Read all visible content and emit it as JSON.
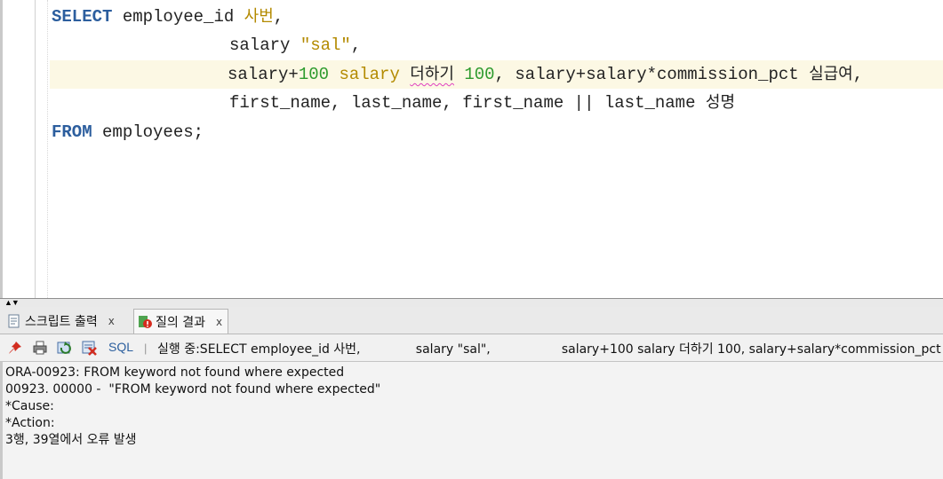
{
  "editor": {
    "line1": {
      "kw": "SELECT",
      "rest": " employee_id ",
      "alias": "사번",
      "tail": ","
    },
    "line2": {
      "col": "salary ",
      "str": "\"sal\"",
      "tail": ","
    },
    "line3": {
      "p1": "salary+",
      "n1": "100",
      "sp1": " ",
      "alias1": "salary",
      "sp2": " ",
      "ko1": "더하기",
      "sp3": " ",
      "n2": "100",
      "p2": ", salary+salary*commission_pct ",
      "ko2": "실급여",
      "tail": ","
    },
    "line4": {
      "text": "first_name, last_name, first_name || last_name ",
      "ko": "성명"
    },
    "line5": {
      "kw": "FROM",
      "rest": " employees;"
    }
  },
  "tabs": [
    {
      "label": "스크립트 출력",
      "close": "x",
      "icon": "script-output-icon"
    },
    {
      "label": "질의 결과",
      "close": "x",
      "icon": "query-result-icon"
    }
  ],
  "toolbar": {
    "sql_label": "SQL",
    "separator": "|",
    "status": "실행 중:SELECT employee_id 사번,              salary \"sal\",                  salary+100 salary 더하기 100, salary+salary*commission_pct 실급여,",
    "icons": [
      "pin-icon",
      "print-icon",
      "refresh-icon",
      "clear-icon"
    ]
  },
  "output": {
    "lines": [
      "ORA-00923: FROM keyword not found where expected",
      "00923. 00000 -  \"FROM keyword not found where expected\"",
      "*Cause:",
      "*Action:",
      "3행, 39열에서 오류 발생"
    ]
  },
  "colors": {
    "keyword": "#2c5e9e",
    "string": "#b38a00",
    "number": "#2e9b2e",
    "current_line": "#fcf8e4"
  }
}
